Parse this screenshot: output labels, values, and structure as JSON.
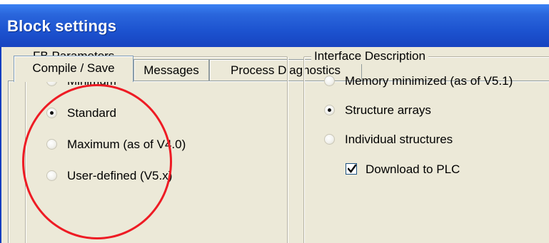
{
  "window": {
    "title": "Block settings"
  },
  "tabs": [
    {
      "label": "Compile / Save",
      "active": true
    },
    {
      "label": "Messages",
      "active": false
    },
    {
      "label": "Process Diagnostics",
      "active": false
    }
  ],
  "fb_parameters": {
    "title": "FB Parameters",
    "options": [
      {
        "label": "Minimum",
        "selected": false
      },
      {
        "label": "Standard",
        "selected": true
      },
      {
        "label": "Maximum (as of V4.0)",
        "selected": false
      },
      {
        "label": "User-defined (V5.x)",
        "selected": false
      }
    ]
  },
  "interface_description": {
    "title": "Interface Description",
    "options": [
      {
        "label": "Memory minimized (as of V5.1)",
        "selected": false
      },
      {
        "label": "Structure arrays",
        "selected": true
      },
      {
        "label": "Individual structures",
        "selected": false
      }
    ],
    "download_checkbox": {
      "label": "Download to PLC",
      "checked": true
    }
  },
  "annotation": {
    "color": "#ee1b24",
    "shape": "ellipse-around-fb-parameters"
  },
  "colors": {
    "title_bar": "#1c52cf",
    "dialog_bg": "#ece9d8"
  }
}
